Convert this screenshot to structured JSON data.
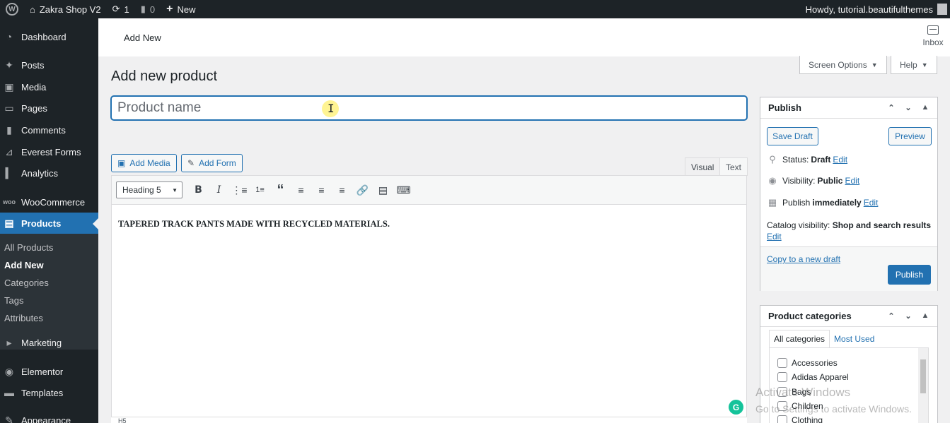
{
  "admin_bar": {
    "site_name": "Zakra Shop V2",
    "updates_count": "1",
    "comments_count": "0",
    "new_label": "New",
    "howdy": "Howdy, tutorial.beautifulthemes"
  },
  "sidebar": {
    "items": [
      {
        "label": "Dashboard",
        "icon": "dashboard-icon"
      },
      {
        "label": "Posts",
        "icon": "pin-icon"
      },
      {
        "label": "Media",
        "icon": "media-icon"
      },
      {
        "label": "Pages",
        "icon": "pages-icon"
      },
      {
        "label": "Comments",
        "icon": "comment-icon"
      },
      {
        "label": "Everest Forms",
        "icon": "forms-icon"
      },
      {
        "label": "Analytics",
        "icon": "bar-chart-icon"
      },
      {
        "label": "WooCommerce",
        "icon": "woo-icon"
      },
      {
        "label": "Products",
        "icon": "archive-icon"
      },
      {
        "label": "Marketing",
        "icon": "megaphone-icon"
      },
      {
        "label": "Elementor",
        "icon": "elementor-icon"
      },
      {
        "label": "Templates",
        "icon": "folder-icon"
      },
      {
        "label": "Appearance",
        "icon": "brush-icon"
      }
    ],
    "submenu": [
      "All Products",
      "Add New",
      "Categories",
      "Tags",
      "Attributes"
    ]
  },
  "topbar": {
    "crumb": "Add New",
    "inbox_label": "Inbox"
  },
  "screen_options_label": "Screen Options",
  "help_label": "Help",
  "page_title": "Add new product",
  "title_input": {
    "placeholder": "Product name",
    "value": ""
  },
  "media_buttons": {
    "add_media": "Add Media",
    "add_form": "Add Form"
  },
  "editor": {
    "tab_visual": "Visual",
    "tab_text": "Text",
    "format_select": "Heading 5",
    "content": "TAPERED TRACK PANTS MADE WITH RECYCLED MATERIALS.",
    "status_path": "H5"
  },
  "publish_box": {
    "title": "Publish",
    "save_draft": "Save Draft",
    "preview": "Preview",
    "status_label": "Status:",
    "status_value": "Draft",
    "visibility_label": "Visibility:",
    "visibility_value": "Public",
    "publish_label": "Publish",
    "publish_value": "immediately",
    "edit_link": "Edit",
    "catalog_label": "Catalog visibility:",
    "catalog_value": "Shop and search results",
    "copy_draft": "Copy to a new draft",
    "publish_button": "Publish"
  },
  "categories_box": {
    "title": "Product categories",
    "tab_all": "All categories",
    "tab_most_used": "Most Used",
    "items": [
      "Accessories",
      "Adidas Apparel",
      "Bags",
      "Children",
      "Clothing"
    ]
  },
  "watermark": {
    "line1": "Activate Windows",
    "line2": "Go to Settings to activate Windows."
  }
}
